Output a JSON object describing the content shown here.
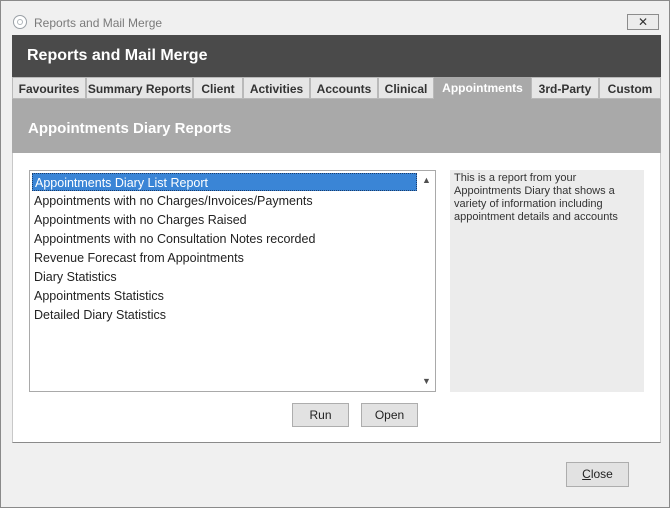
{
  "window": {
    "title": "Reports and Mail Merge",
    "close_glyph": "✕"
  },
  "header": {
    "title": "Reports and Mail Merge"
  },
  "tabs": [
    {
      "label": "Favourites",
      "active": false
    },
    {
      "label": "Summary Reports",
      "active": false
    },
    {
      "label": "Client",
      "active": false
    },
    {
      "label": "Activities",
      "active": false
    },
    {
      "label": "Accounts",
      "active": false
    },
    {
      "label": "Clinical",
      "active": false
    },
    {
      "label": "Appointments",
      "active": true
    },
    {
      "label": "3rd-Party",
      "active": false
    },
    {
      "label": "Custom",
      "active": false
    }
  ],
  "section": {
    "title": "Appointments Diary Reports"
  },
  "reports": {
    "items": [
      {
        "label": "Appointments Diary List Report",
        "selected": true
      },
      {
        "label": "Appointments with no Charges/Invoices/Payments",
        "selected": false
      },
      {
        "label": "Appointments with no Charges Raised",
        "selected": false
      },
      {
        "label": "Appointments with no Consultation Notes recorded",
        "selected": false
      },
      {
        "label": "Revenue Forecast from Appointments",
        "selected": false
      },
      {
        "label": "Diary Statistics",
        "selected": false
      },
      {
        "label": "Appointments Statistics",
        "selected": false
      },
      {
        "label": "Detailed Diary Statistics",
        "selected": false
      }
    ],
    "scroll_up_glyph": "▲",
    "scroll_down_glyph": "▼"
  },
  "description": {
    "text": "This is a report from your Appointments Diary that shows a variety of information including appointment details and accounts"
  },
  "buttons": {
    "run": "Run",
    "open": "Open",
    "close_underlined": "C",
    "close_rest": "lose"
  },
  "colors": {
    "header_bg": "#4a4a4a",
    "section_bg": "#a9a9a9",
    "selection": "#3a85d6"
  },
  "icons": {
    "app": "app-logo-icon",
    "close": "close-icon",
    "scroll_up": "chevron-up-icon",
    "scroll_down": "chevron-down-icon"
  }
}
